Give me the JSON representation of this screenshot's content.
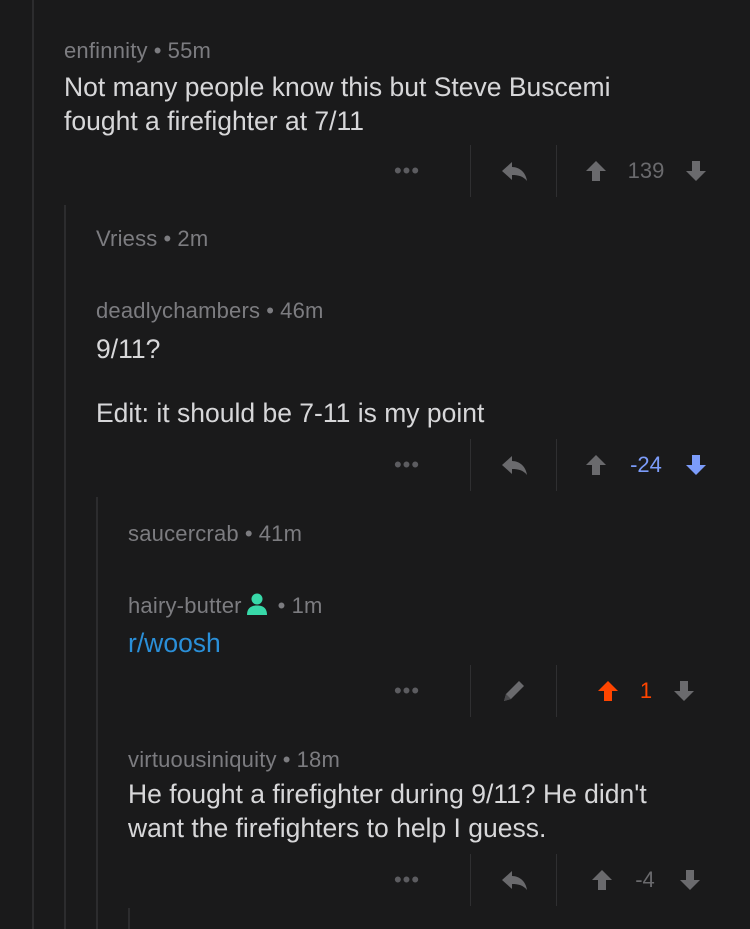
{
  "comments": [
    {
      "author": "enfinnity",
      "age": "55m",
      "body_lines": [
        "Not many people know this but Steve Buscemi",
        "fought a firefighter at 7/11"
      ],
      "score": "139"
    },
    {
      "author": "Vriess",
      "age": "2m"
    },
    {
      "author": "deadlychambers",
      "age": "46m",
      "body_lines": [
        "9/11?",
        "",
        "Edit: it should be 7-11 is my point"
      ],
      "score": "-24"
    },
    {
      "author": "saucercrab",
      "age": "41m"
    },
    {
      "author": "hairy-butter",
      "age": "1m",
      "link": "r/woosh",
      "score": "1"
    },
    {
      "author": "virtuousiniquity",
      "age": "18m",
      "body_lines": [
        "He fought a firefighter during 9/11? He didn't",
        "want the firefighters to help I guess."
      ],
      "score": "-4"
    }
  ],
  "separator": "•",
  "more_label": "•••",
  "colors": {
    "background": "#1a1a1b",
    "downvote_active": "#7c9cfa",
    "upvote_active": "#ff4500",
    "link": "#2a8fd8",
    "mod_badge": "#38d9a9"
  },
  "icons": [
    "more-icon",
    "reply-icon",
    "upvote-icon",
    "downvote-icon",
    "edit-icon",
    "moderator-icon"
  ]
}
